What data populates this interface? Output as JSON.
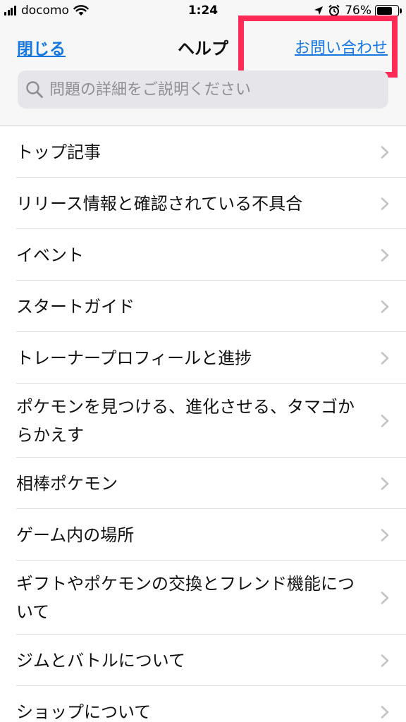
{
  "status": {
    "carrier": "docomo",
    "time": "1:24",
    "battery": "76%",
    "battery_level": 0.76
  },
  "nav": {
    "close_label": "閉じる",
    "title": "ヘルプ",
    "contact_label": "お問い合わせ"
  },
  "search": {
    "placeholder": "問題の詳細をご説明ください"
  },
  "list": {
    "items": [
      {
        "label": "トップ記事"
      },
      {
        "label": "リリース情報と確認されている不具合"
      },
      {
        "label": "イベント"
      },
      {
        "label": "スタートガイド"
      },
      {
        "label": "トレーナープロフィールと進捗"
      },
      {
        "label": "ポケモンを見つける、進化させる、タマゴからかえす"
      },
      {
        "label": "相棒ポケモン"
      },
      {
        "label": "ゲーム内の場所"
      },
      {
        "label": "ギフトやポケモンの交換とフレンド機能について"
      },
      {
        "label": "ジムとバトルについて"
      },
      {
        "label": "ショップについて"
      }
    ]
  },
  "colors": {
    "link_blue": "#1578e0",
    "highlight_red": "#ff2a55",
    "bar_bg": "#f7f7f7"
  }
}
